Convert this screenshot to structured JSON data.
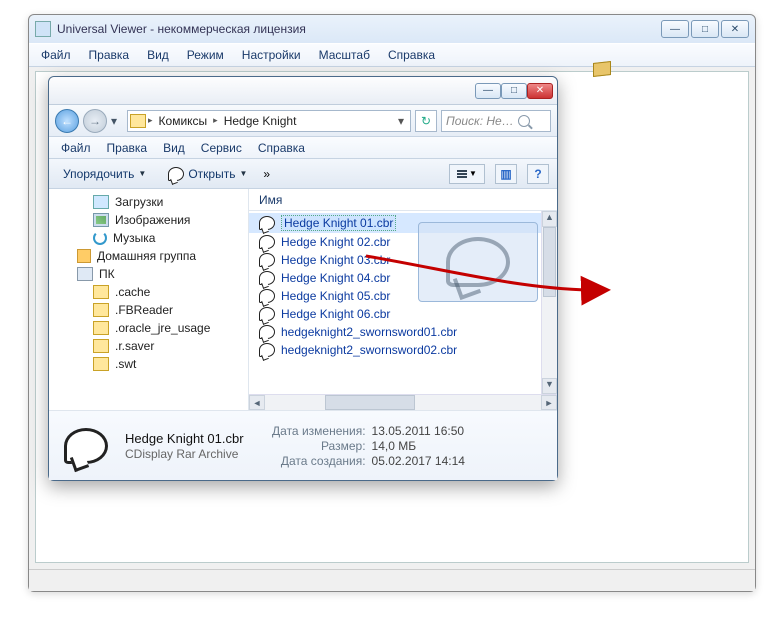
{
  "main": {
    "title": "Universal Viewer - некоммерческая лицензия",
    "menu": [
      "Файл",
      "Правка",
      "Вид",
      "Режим",
      "Настройки",
      "Масштаб",
      "Справка"
    ]
  },
  "explorer": {
    "breadcrumbs": [
      "Комиксы",
      "Hedge Knight"
    ],
    "search_placeholder": "Поиск: He…",
    "menu": [
      "Файл",
      "Правка",
      "Вид",
      "Сервис",
      "Справка"
    ],
    "toolbar": {
      "organize": "Упорядочить",
      "open": "Открыть"
    },
    "tree": [
      {
        "label": "Загрузки",
        "icon": "dl",
        "level": 1
      },
      {
        "label": "Изображения",
        "icon": "img",
        "level": 1
      },
      {
        "label": "Музыка",
        "icon": "music",
        "level": 1
      },
      {
        "label": "Домашняя группа",
        "icon": "home",
        "level": 0
      },
      {
        "label": "ПК",
        "icon": "pc",
        "level": 0
      },
      {
        "label": ".cache",
        "icon": "folder",
        "level": 1
      },
      {
        "label": ".FBReader",
        "icon": "folder",
        "level": 1
      },
      {
        "label": ".oracle_jre_usage",
        "icon": "folder",
        "level": 1
      },
      {
        "label": ".r.saver",
        "icon": "folder",
        "level": 1
      },
      {
        "label": ".swt",
        "icon": "folder",
        "level": 1
      }
    ],
    "column_header": "Имя",
    "files": [
      {
        "name": "Hedge Knight 01.cbr",
        "selected": true
      },
      {
        "name": "Hedge Knight 02.cbr",
        "selected": false
      },
      {
        "name": "Hedge Knight 03.cbr",
        "selected": false
      },
      {
        "name": "Hedge Knight 04.cbr",
        "selected": false
      },
      {
        "name": "Hedge Knight 05.cbr",
        "selected": false
      },
      {
        "name": "Hedge Knight 06.cbr",
        "selected": false
      },
      {
        "name": "hedgeknight2_swornsword01.cbr",
        "selected": false
      },
      {
        "name": "hedgeknight2_swornsword02.cbr",
        "selected": false
      }
    ],
    "details": {
      "name": "Hedge Knight 01.cbr",
      "type": "CDisplay Rar Archive",
      "modified_label": "Дата изменения:",
      "modified": "13.05.2011 16:50",
      "size_label": "Размер:",
      "size": "14,0 МБ",
      "created_label": "Дата создания:",
      "created": "05.02.2017 14:14"
    }
  }
}
